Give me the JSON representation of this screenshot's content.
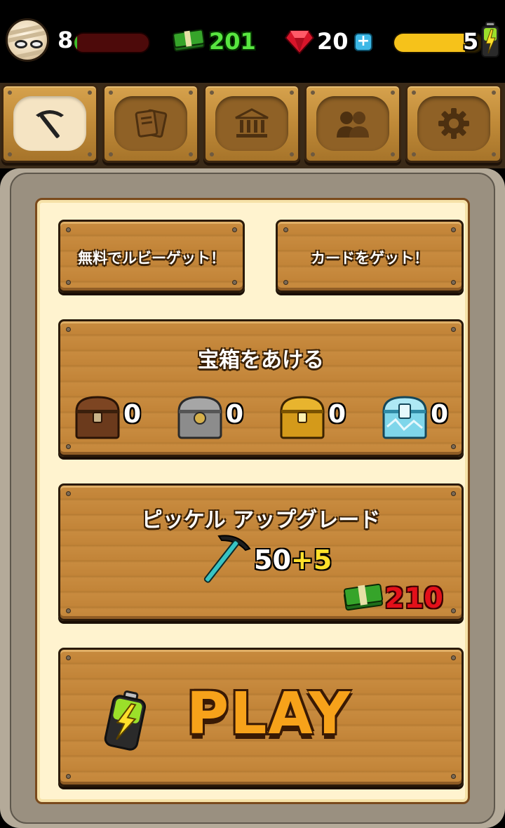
{
  "status": {
    "level": "8",
    "xp_fraction": 0.04,
    "cash": "201",
    "rubies": "20",
    "add_rubies": "+",
    "energy": "5",
    "energy_fraction": 0.8,
    "colors": {
      "cash": "#58e640",
      "xp_bar": "#4d0a0a",
      "energy_bar": "#f6c21a"
    }
  },
  "tabs": [
    {
      "icon": "pickaxe-icon",
      "active": true
    },
    {
      "icon": "cards-icon",
      "active": false
    },
    {
      "icon": "bank-icon",
      "active": false
    },
    {
      "icon": "friends-icon",
      "active": false
    },
    {
      "icon": "settings-icon",
      "active": false
    }
  ],
  "main": {
    "free_ruby_label": "無料でルビーゲット！",
    "get_card_label": "カードをゲット！",
    "chests": {
      "title": "宝箱をあける",
      "items": [
        {
          "icon": "wooden-chest-icon",
          "count": "0"
        },
        {
          "icon": "silver-chest-icon",
          "count": "0"
        },
        {
          "icon": "gold-chest-icon",
          "count": "0"
        },
        {
          "icon": "diamond-chest-icon",
          "count": "0"
        }
      ]
    },
    "pickaxe_upgrade": {
      "title": "ピッケル アップグレード",
      "value": "50",
      "bonus": "+5",
      "cost": "210",
      "cost_color": "#e3101a"
    },
    "play": {
      "label": "PLAY",
      "color": "#f7a21a"
    }
  }
}
